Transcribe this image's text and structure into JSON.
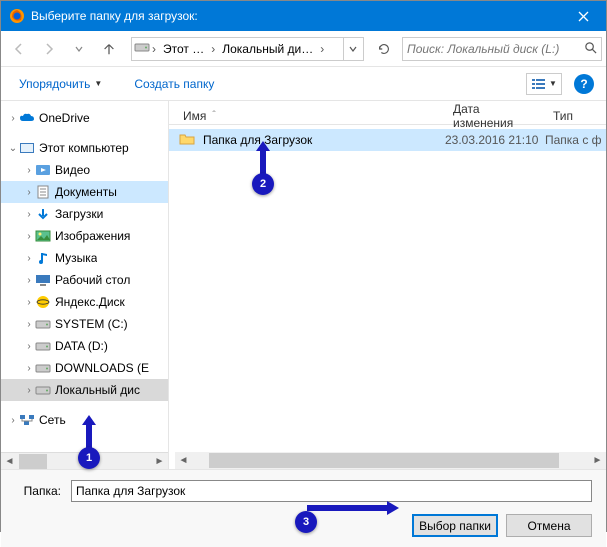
{
  "title": "Выберите папку для загрузок:",
  "nav": {
    "crumbs": [
      "Этот …",
      "Локальный ди…"
    ],
    "search_placeholder": "Поиск: Локальный диск (L:)"
  },
  "toolbar": {
    "organize": "Упорядочить",
    "new_folder": "Создать папку",
    "help": "?"
  },
  "columns": {
    "name": "Имя",
    "date": "Дата изменения",
    "type": "Тип"
  },
  "sidebar": {
    "items": [
      {
        "label": "OneDrive",
        "level": 0,
        "expand": ">",
        "icon": "cloud"
      },
      {
        "label": "",
        "level": 0,
        "spacer": true
      },
      {
        "label": "Этот компьютер",
        "level": 0,
        "expand": "v",
        "icon": "pc"
      },
      {
        "label": "Видео",
        "level": 1,
        "expand": ">",
        "icon": "video"
      },
      {
        "label": "Документы",
        "level": 1,
        "expand": ">",
        "icon": "docs",
        "selected": true
      },
      {
        "label": "Загрузки",
        "level": 1,
        "expand": ">",
        "icon": "down"
      },
      {
        "label": "Изображения",
        "level": 1,
        "expand": ">",
        "icon": "pics"
      },
      {
        "label": "Музыка",
        "level": 1,
        "expand": ">",
        "icon": "music"
      },
      {
        "label": "Рабочий стол",
        "level": 1,
        "expand": ">",
        "icon": "desktop"
      },
      {
        "label": "Яндекс.Диск",
        "level": 1,
        "expand": ">",
        "icon": "yadisk"
      },
      {
        "label": "SYSTEM (C:)",
        "level": 1,
        "expand": ">",
        "icon": "drive"
      },
      {
        "label": "DATA (D:)",
        "level": 1,
        "expand": ">",
        "icon": "drive"
      },
      {
        "label": "DOWNLOADS (E",
        "level": 1,
        "expand": ">",
        "icon": "drive"
      },
      {
        "label": "Локальный дис",
        "level": 1,
        "expand": ">",
        "icon": "drive",
        "active": true
      },
      {
        "label": "",
        "level": 0,
        "spacer": true
      },
      {
        "label": "Сеть",
        "level": 0,
        "expand": ">",
        "icon": "net"
      }
    ]
  },
  "files": [
    {
      "name": "Папка для Загрузок",
      "date": "23.03.2016 21:10",
      "type": "Папка с ф",
      "selected": true,
      "icon": "folder"
    }
  ],
  "bottom": {
    "folder_label": "Папка:",
    "folder_value": "Папка для Загрузок",
    "select_btn": "Выбор папки",
    "cancel_btn": "Отмена"
  },
  "annotations": {
    "a1": "1",
    "a2": "2",
    "a3": "3"
  }
}
